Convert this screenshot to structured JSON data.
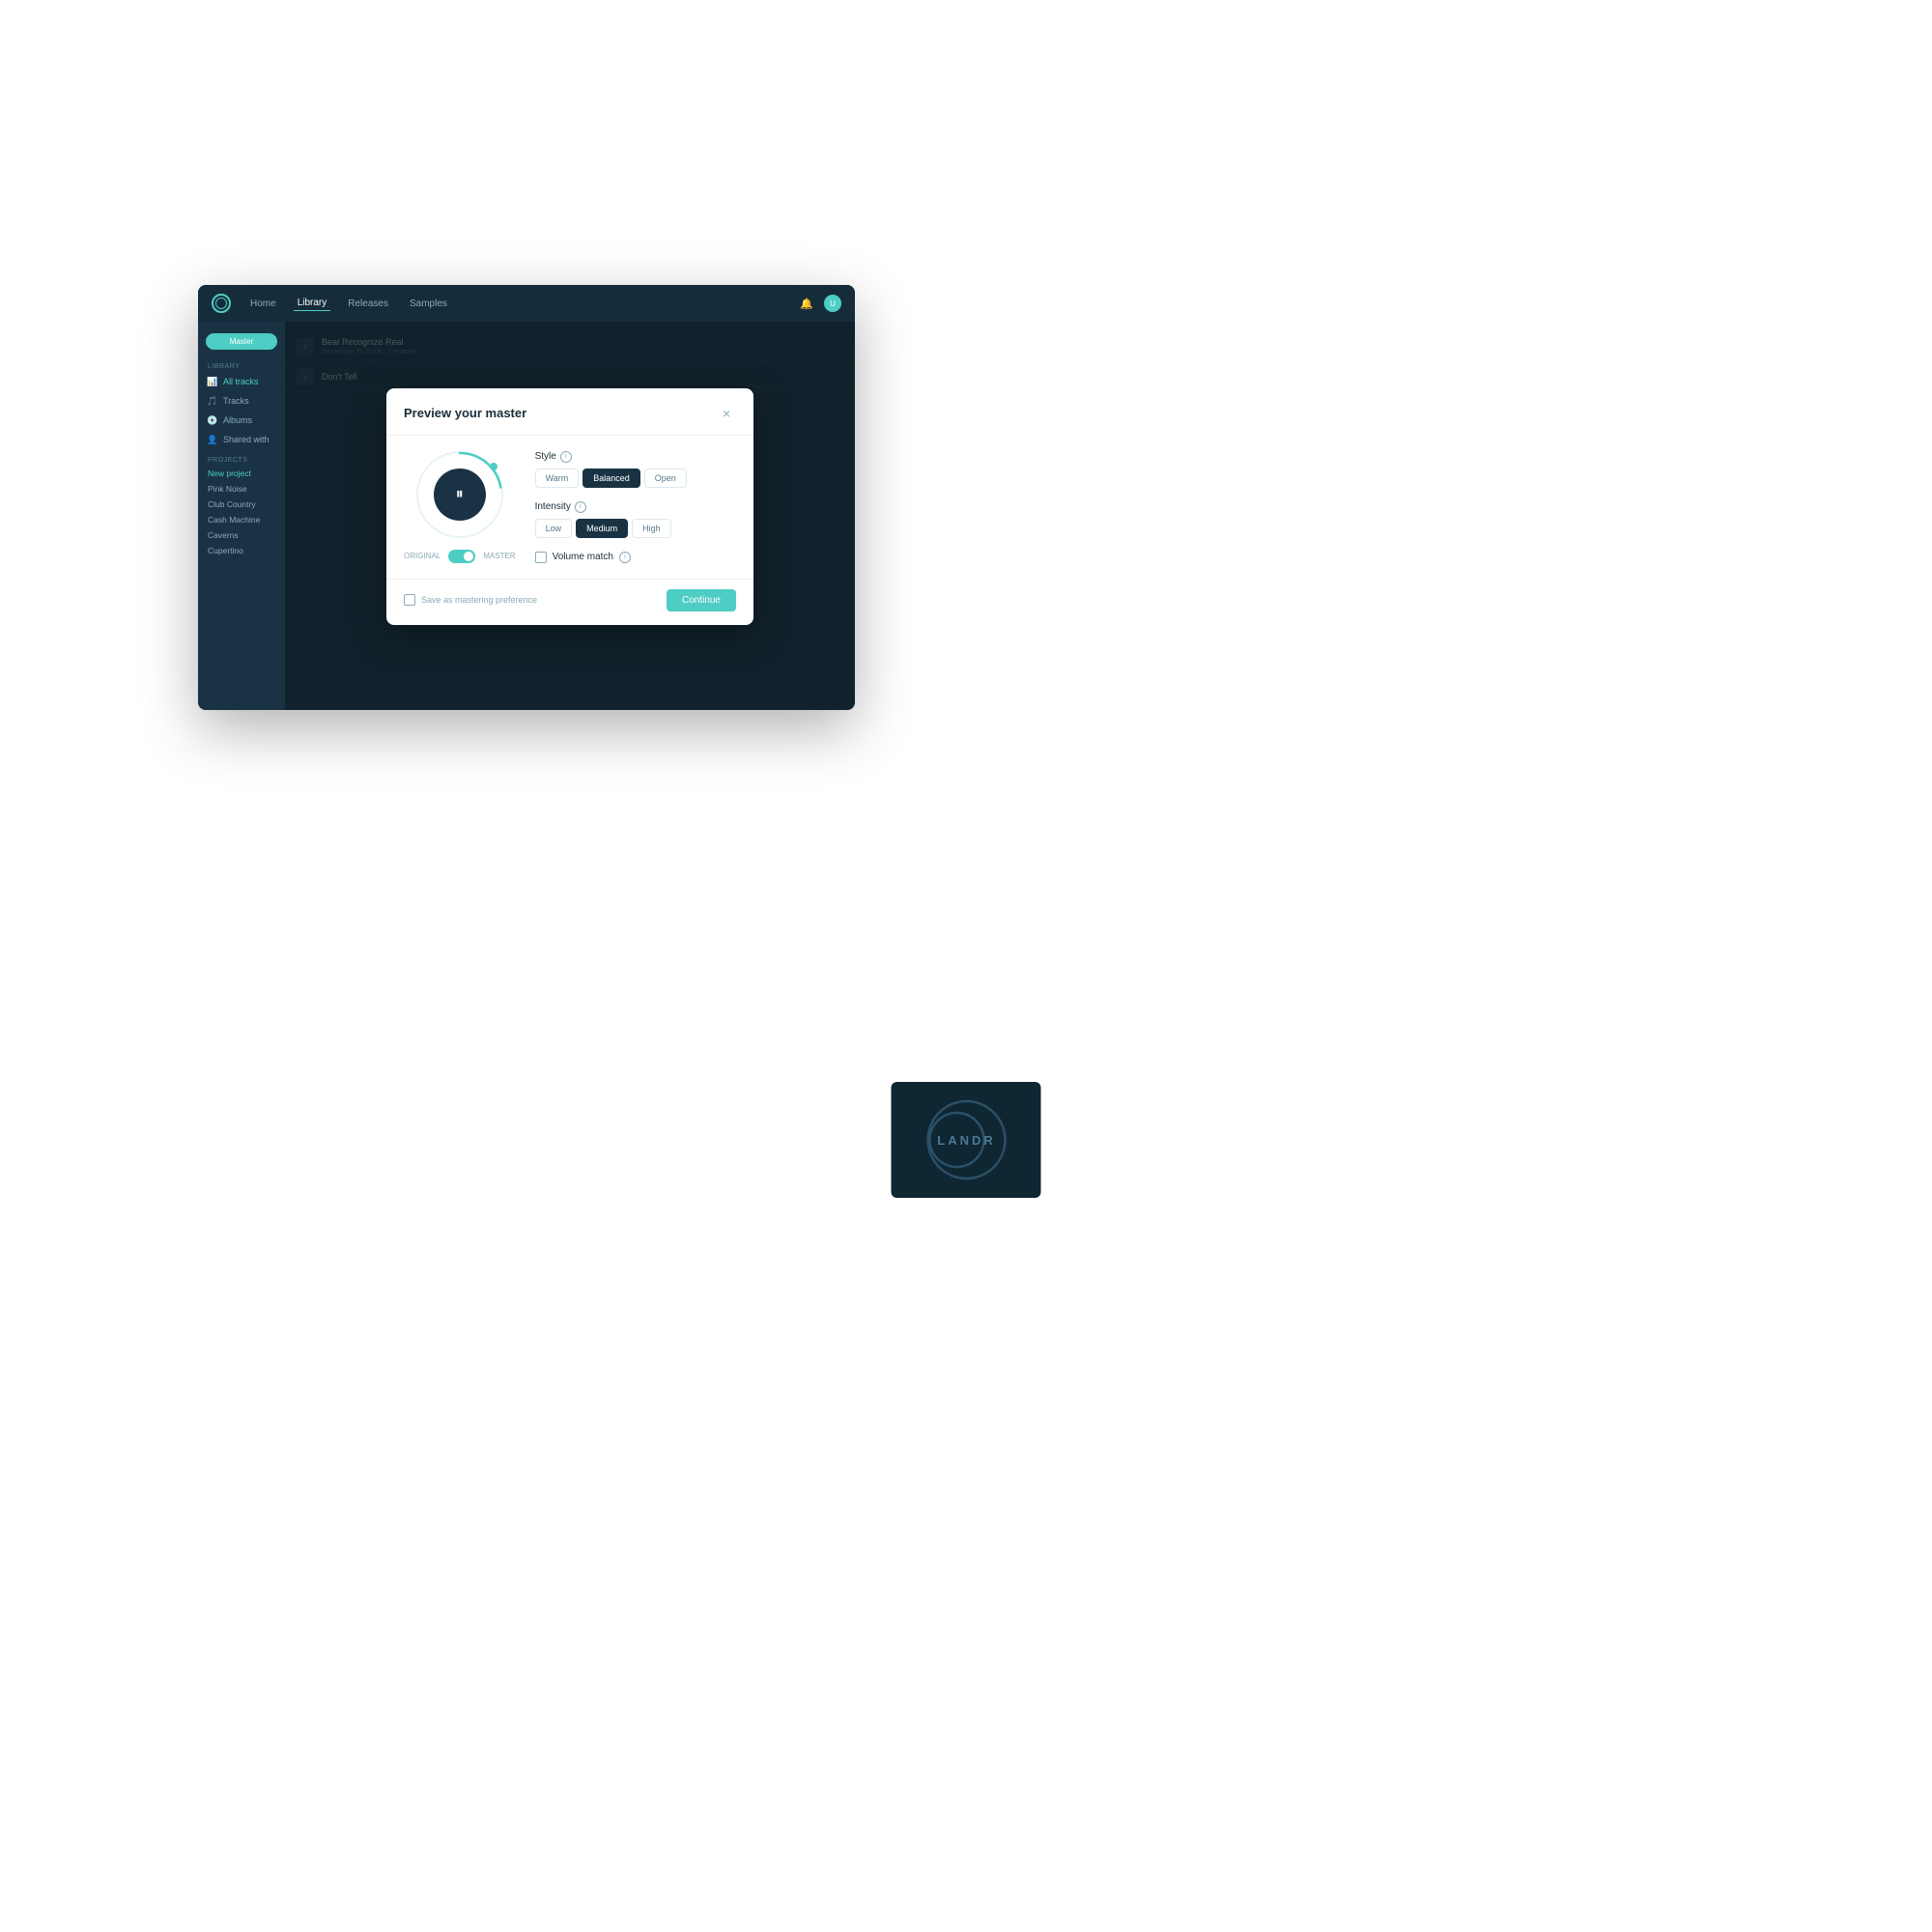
{
  "nav": {
    "links": [
      "Home",
      "Library",
      "Releases",
      "Samples"
    ],
    "active": "Library"
  },
  "sidebar": {
    "master_button": "Master",
    "library_label": "LIBRARY",
    "items": [
      {
        "id": "all-tracks",
        "label": "All tracks",
        "icon": "📊"
      },
      {
        "id": "tracks",
        "label": "Tracks",
        "icon": "🎵"
      },
      {
        "id": "albums",
        "label": "Albums",
        "icon": "💿"
      },
      {
        "id": "shared-with",
        "label": "Shared with",
        "icon": "👤"
      }
    ],
    "projects_label": "PROJECTS",
    "projects": [
      {
        "id": "new-project",
        "label": "New project",
        "active": true
      },
      {
        "id": "pink-noise",
        "label": "Pink Noise"
      },
      {
        "id": "club-country",
        "label": "Club Country"
      },
      {
        "id": "cash-machine",
        "label": "Cash Machine"
      },
      {
        "id": "caverns",
        "label": "Caverns"
      },
      {
        "id": "cupertino",
        "label": "Cupertino"
      }
    ]
  },
  "content_rows": [
    {
      "title": "Beat Recognize Real",
      "meta": "December 5, 2018 · 1 master",
      "icon": "🎵"
    },
    {
      "title": "Don't Tell",
      "meta": "",
      "icon": "🎵"
    }
  ],
  "modal": {
    "title": "Preview your master",
    "close_label": "×",
    "style_label": "Style",
    "style_options": [
      "Warm",
      "Balanced",
      "Open"
    ],
    "style_active": "Balanced",
    "intensity_label": "Intensity",
    "intensity_options": [
      "Low",
      "Medium",
      "High"
    ],
    "intensity_active": "Medium",
    "volume_match_label": "Volume match",
    "save_pref_label": "Save as mastering preference",
    "continue_label": "Continue",
    "player": {
      "original_label": "ORIGINAL",
      "master_label": "MASTER"
    }
  },
  "landr": {
    "brand": "LANDR"
  }
}
